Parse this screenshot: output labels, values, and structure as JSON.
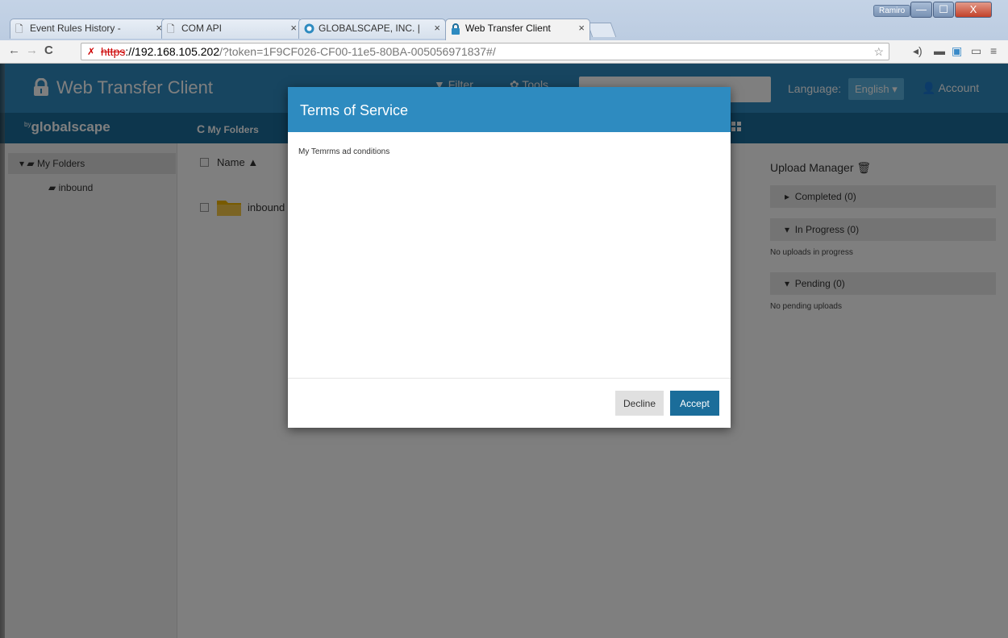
{
  "browser": {
    "tabs": [
      {
        "label": "Event Rules History - ",
        "icon": "page-icon",
        "active": false
      },
      {
        "label": "COM API",
        "icon": "page-icon",
        "active": false
      },
      {
        "label": "GLOBALSCAPE, INC. |",
        "icon": "globalscape-favicon",
        "active": false
      },
      {
        "label": "Web Transfer Client",
        "icon": "lock-favicon",
        "active": true
      }
    ],
    "window_user": "Ramiro",
    "url": {
      "scheme": "https",
      "host": "://192.168.105.202",
      "rest": "/?token=1F9CF026-CF00-11e5-80BA-005056971837#/"
    }
  },
  "app": {
    "brand": "Web Transfer Client",
    "filter_label": "Filter",
    "tools_label": "Tools",
    "language_label": "Language:",
    "language_value": "English",
    "account_label": "Account",
    "byline_prefix": "by",
    "byline_name": "globalscape",
    "refresh_label": "My Folders",
    "accent_color": "#2e8bc0",
    "dark_accent_color": "#1b6d9a"
  },
  "tree": {
    "root": "My Folders",
    "children": [
      "inbound"
    ]
  },
  "files": {
    "column_name": "Name",
    "rows": [
      {
        "name": "inbound",
        "type": "folder"
      }
    ]
  },
  "upload_manager": {
    "title": "Upload Manager",
    "sections": [
      {
        "label": "Completed (0)",
        "expanded": false
      },
      {
        "label": "In Progress (0)",
        "expanded": true,
        "note": "No uploads in progress"
      },
      {
        "label": "Pending (0)",
        "expanded": true,
        "note": "No pending uploads"
      }
    ]
  },
  "modal": {
    "title": "Terms of Service",
    "body": "My Temrms ad conditions",
    "decline_label": "Decline",
    "accept_label": "Accept"
  }
}
